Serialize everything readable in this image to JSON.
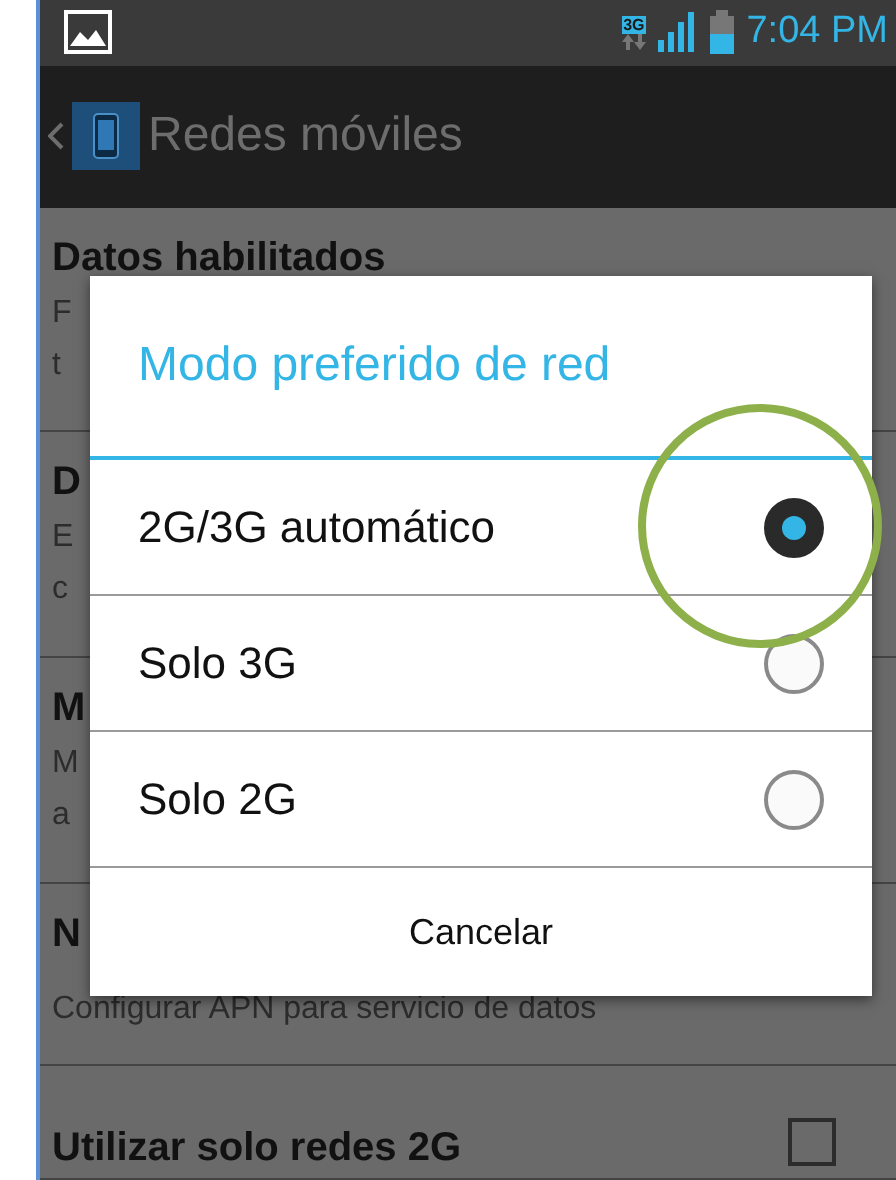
{
  "status_bar": {
    "network_type": "3G",
    "time": "7:04 PM"
  },
  "action_bar": {
    "title": "Redes móviles"
  },
  "settings": [
    {
      "kind": "text",
      "title": "Datos habilitados",
      "summary_lines": [
        "F",
        "t"
      ]
    },
    {
      "kind": "text",
      "title": "D",
      "summary_lines": [
        "E",
        "c"
      ]
    },
    {
      "kind": "text",
      "title": "M",
      "summary_lines": [
        "M",
        "a"
      ]
    },
    {
      "kind": "text",
      "title": "N",
      "summary_lines": [
        "Configurar APN para servicio de datos"
      ]
    },
    {
      "kind": "checkbox",
      "title": "Utilizar solo redes 2G",
      "checked": false
    }
  ],
  "dialog": {
    "title": "Modo preferido de red",
    "options": [
      {
        "label": "2G/3G automático",
        "selected": true
      },
      {
        "label": "Solo 3G",
        "selected": false
      },
      {
        "label": "Solo 2G",
        "selected": false
      }
    ],
    "button": "Cancelar"
  }
}
